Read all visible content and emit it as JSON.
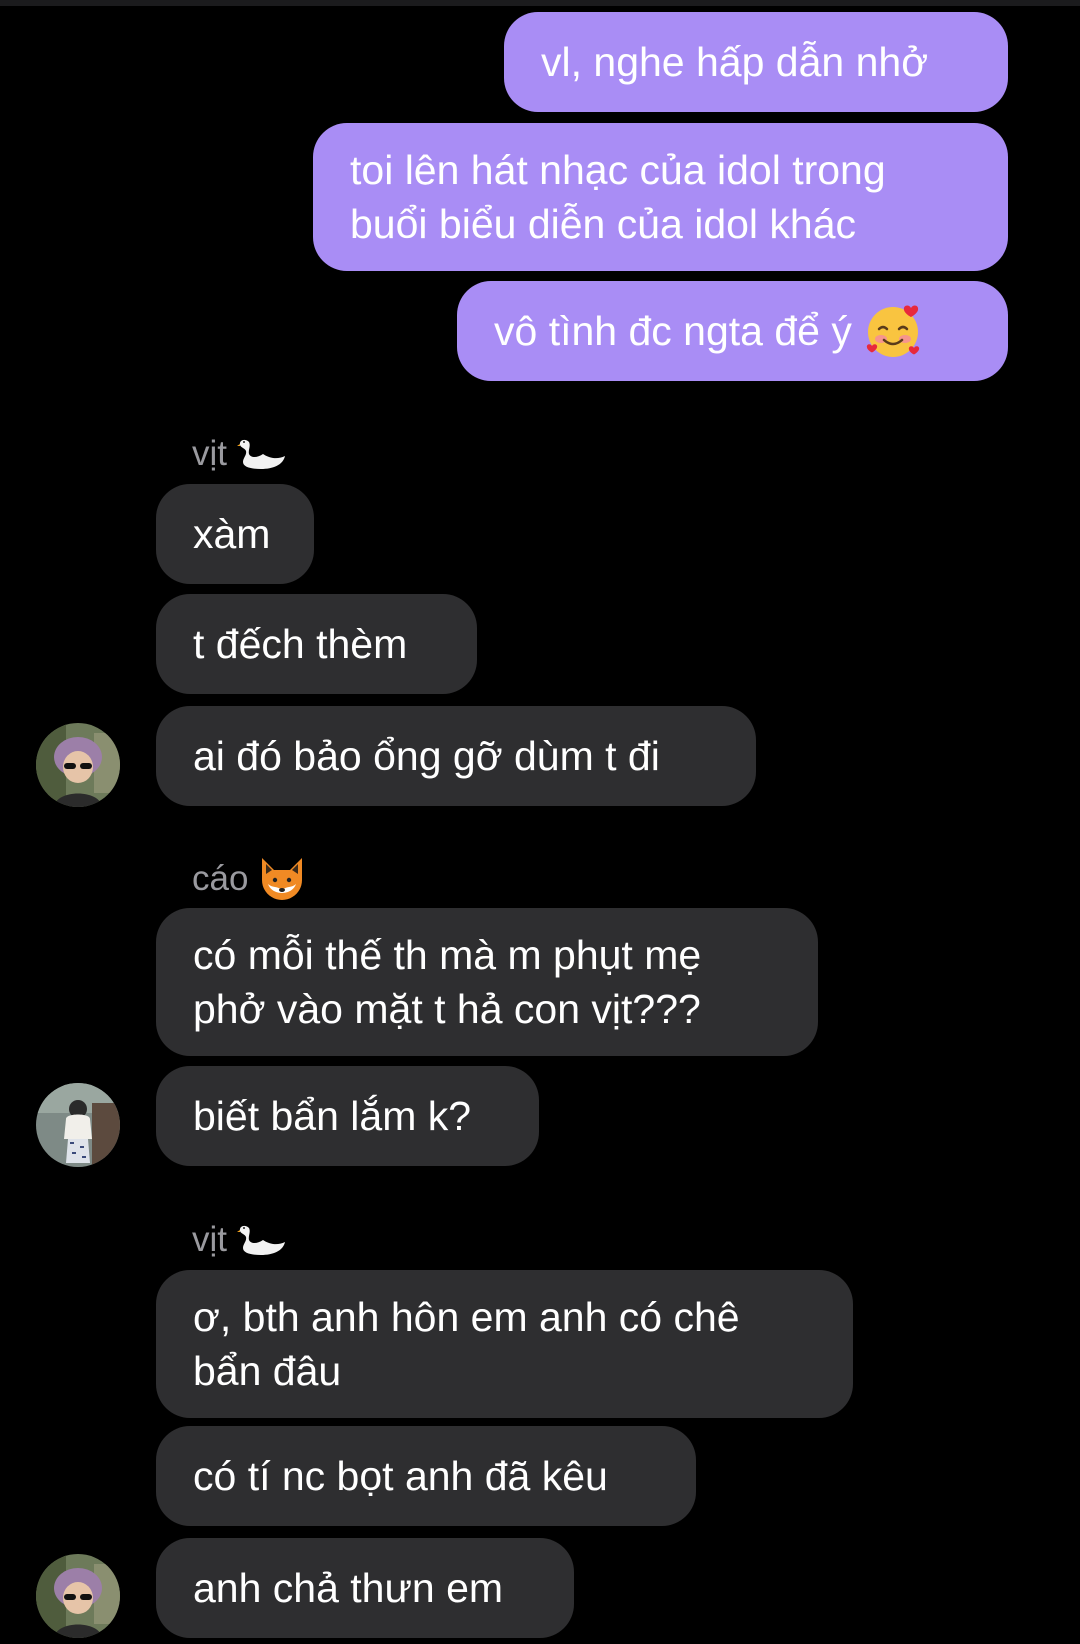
{
  "outgoing": [
    {
      "lines": [
        "vl, nghe hấp dẫn nhở"
      ]
    },
    {
      "lines": [
        "toi lên hát nhạc của idol trong",
        "buổi biểu diễn của idol khác"
      ]
    },
    {
      "text": "vô tình đc ngta để ý",
      "emoji": "smiling-face-with-hearts"
    }
  ],
  "groups": [
    {
      "sender": "vịt",
      "sender_emoji": "swan",
      "messages": [
        {
          "lines": [
            "xàm"
          ]
        },
        {
          "lines": [
            "t đếch thèm"
          ]
        },
        {
          "lines": [
            "ai đó bảo ổng gỡ dùm t đi"
          ]
        }
      ]
    },
    {
      "sender": "cáo",
      "sender_emoji": "fox",
      "messages": [
        {
          "lines": [
            "có mỗi thế th mà m phụt mẹ",
            "phở vào mặt t hả con vịt???"
          ]
        },
        {
          "lines": [
            "biết bẩn lắm k?"
          ]
        }
      ]
    },
    {
      "sender": "vịt",
      "sender_emoji": "swan",
      "messages": [
        {
          "lines": [
            "ơ, bth anh hôn em anh có chê",
            "bẩn đâu"
          ]
        },
        {
          "lines": [
            "có tí nc bọt anh đã kêu"
          ]
        },
        {
          "lines": [
            "anh chả thưn em"
          ]
        }
      ]
    }
  ],
  "colors": {
    "background": "#000000",
    "outgoing_bubble": "#a98df5",
    "incoming_bubble": "#2e2e30",
    "sender_name": "#9a9a9f",
    "text": "#ffffff"
  }
}
